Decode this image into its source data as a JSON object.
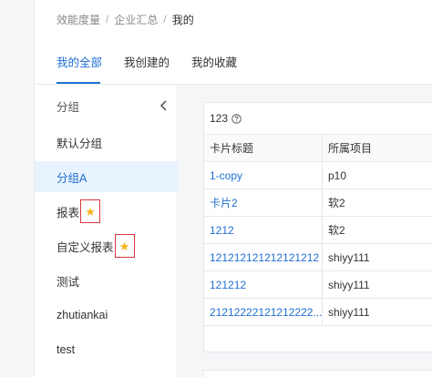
{
  "breadcrumb": {
    "items": [
      "效能度量",
      "企业汇总"
    ],
    "current": "我的",
    "separator": "/"
  },
  "tabs": [
    {
      "label": "我的全部",
      "active": true
    },
    {
      "label": "我创建的",
      "active": false
    },
    {
      "label": "我的收藏",
      "active": false
    }
  ],
  "sidebar": {
    "header": "分组",
    "items": [
      {
        "label": "默认分组",
        "selected": false,
        "starred": false
      },
      {
        "label": "分组A",
        "selected": true,
        "starred": false
      },
      {
        "label": "报表",
        "selected": false,
        "starred": true
      },
      {
        "label": "自定义报表",
        "selected": false,
        "starred": true
      },
      {
        "label": "测试",
        "selected": false,
        "starred": false
      },
      {
        "label": "zhutiankai",
        "selected": false,
        "starred": false
      },
      {
        "label": "test",
        "selected": false,
        "starred": false
      }
    ]
  },
  "card": {
    "title": "123",
    "columns": [
      "卡片标题",
      "所属项目"
    ],
    "rows": [
      [
        "1-copy",
        "p10"
      ],
      [
        "卡片2",
        "软2"
      ],
      [
        "1212",
        "软2"
      ],
      [
        "121212121212121212 ...",
        "shiyy111"
      ],
      [
        "121212",
        "shiyy111"
      ],
      [
        "21212222121212222...",
        "shiyy111"
      ]
    ]
  },
  "colors": {
    "accent": "#1f6fd1",
    "selected_bg": "#e9f3fe",
    "star": "#f6b21b",
    "highlight_border": "#d9363e"
  }
}
